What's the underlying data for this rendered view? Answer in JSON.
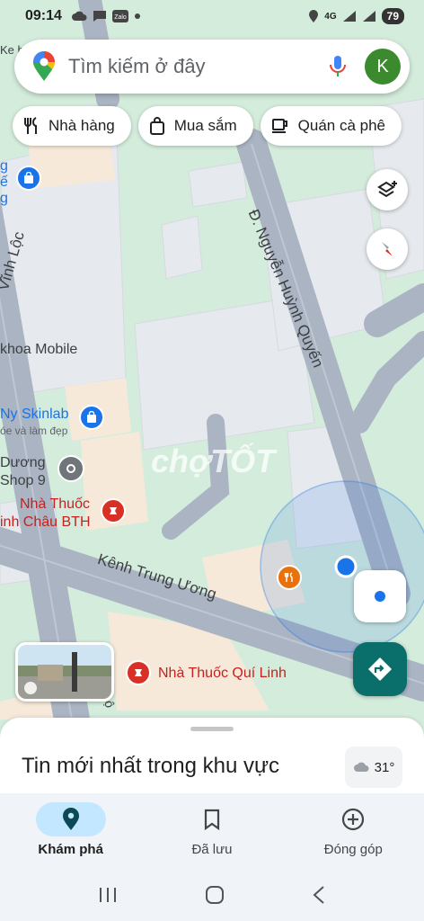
{
  "status_bar": {
    "time": "09:14",
    "network": "4G",
    "battery": "79",
    "left_icons": [
      "cloud-icon",
      "message-icon",
      "zalo-icon",
      "dot-icon"
    ],
    "right_icons": [
      "location-icon",
      "signal-icon",
      "signal-icon",
      "battery-icon"
    ]
  },
  "search": {
    "placeholder": "Tìm kiếm ở đây",
    "avatar_initial": "K"
  },
  "chips": [
    {
      "label": "Nhà hàng",
      "icon": "restaurant-icon"
    },
    {
      "label": "Mua sắm",
      "icon": "shopping-icon"
    },
    {
      "label": "Quán cà phê",
      "icon": "coffee-icon"
    }
  ],
  "map": {
    "streets": [
      "Đ. Nguyễn Huỳnh Quyến",
      "Kênh Trung Ương",
      "Vĩnh Lộc",
      "Lộ"
    ],
    "poi_labels": {
      "ne_fragment": "g",
      "ne_fragment2": "ế",
      "ne_fragment3": "g",
      "ke_fragment": "Ke h",
      "mobile": "khoa Mobile",
      "skinlab": "Ny Skinlab",
      "skinlab_sub": "óe và làm đẹp",
      "duong": "Dương",
      "shop9": "Shop 9",
      "pharmacy1_line1": "Nhà Thuốc",
      "pharmacy1_line2": "inh Châu BTH",
      "pharmacy2": "Nhà Thuốc Quí Linh"
    },
    "watermark": "chợTỐT",
    "colors": {
      "park": "#d4ecdc",
      "road": "#aab4c2",
      "building": "#e6e9ee",
      "location_blue": "#1a73e8"
    }
  },
  "sheet": {
    "title": "Tin mới nhất trong khu vực",
    "temperature": "31°",
    "weather_icon": "cloud-icon"
  },
  "nav": [
    {
      "label": "Khám phá",
      "icon": "location-pin-icon",
      "active": true
    },
    {
      "label": "Đã lưu",
      "icon": "bookmark-icon",
      "active": false
    },
    {
      "label": "Đóng góp",
      "icon": "plus-circle-icon",
      "active": false
    }
  ]
}
